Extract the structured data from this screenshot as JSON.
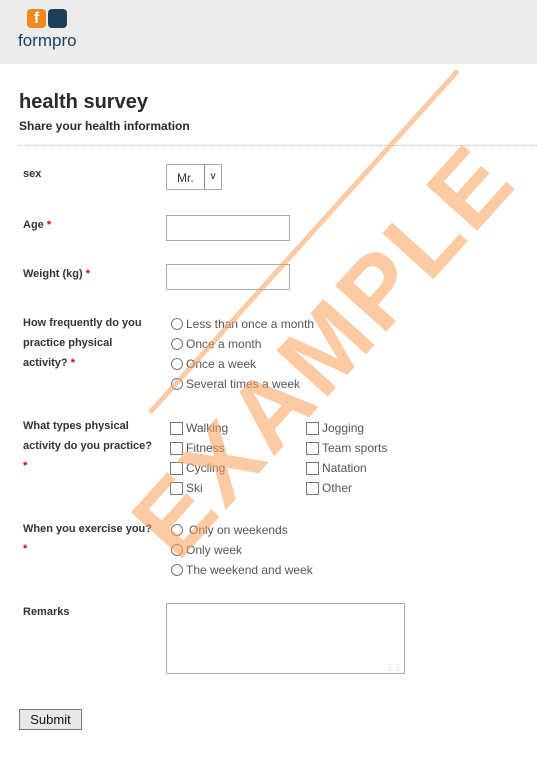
{
  "header": {
    "logo_letter": "f",
    "logo_text": "formpro",
    "brand_orange": "#f08a1c",
    "brand_blue": "#1e3f5a"
  },
  "form": {
    "title": "health survey",
    "subtitle": "Share your health information",
    "required_mark": "*",
    "sex": {
      "label": "sex",
      "value": "Mr."
    },
    "age": {
      "label": "Age",
      "value": ""
    },
    "weight": {
      "label": "Weight (kg)",
      "value": ""
    },
    "frequency": {
      "label": "How frequently do you practice physical activity?",
      "options": [
        "Less than once a month",
        "Once a month",
        "Once a week",
        "Several times a week"
      ]
    },
    "types": {
      "label": "What types physical activity do you practice?",
      "options": [
        "Walking",
        "Fitness",
        "Cycling",
        "Ski",
        "Jogging",
        "Team sports",
        "Natation",
        "Other"
      ]
    },
    "when": {
      "label": "When you exercise you?",
      "options": [
        "Only on weekends",
        "Only week",
        "The weekend and week"
      ]
    },
    "remarks": {
      "label": "Remarks",
      "value": ""
    },
    "submit": "Submit"
  },
  "watermark": "EXAMPLE"
}
